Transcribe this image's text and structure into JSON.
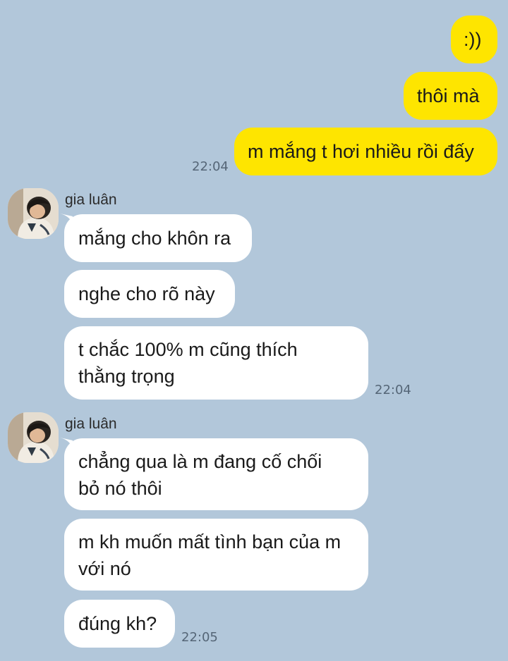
{
  "messages_out": {
    "m1": ":))",
    "m2": "thôi mà",
    "m3": "m mắng t hơi nhiều rồi đấy",
    "time": "22:04"
  },
  "group1": {
    "sender": "gia luân",
    "m1": "mắng cho khôn ra",
    "m2": "nghe cho rõ này",
    "m3_line1": "t chắc 100% m cũng thích",
    "m3_line2": "thằng trọng",
    "time": "22:04"
  },
  "group2": {
    "sender": "gia luân",
    "m1_line1": "chẳng qua là m đang cố chối",
    "m1_line2": "bỏ nó thôi",
    "m2_line1": "m kh muốn mất tình bạn của m",
    "m2_line2": "với nó",
    "m3": "đúng kh?",
    "time": "22:05"
  },
  "colors": {
    "background": "#b2c7da",
    "outgoing_bubble": "#fee500",
    "incoming_bubble": "#ffffff"
  },
  "icons": {
    "avatar": "avatar-photo"
  }
}
